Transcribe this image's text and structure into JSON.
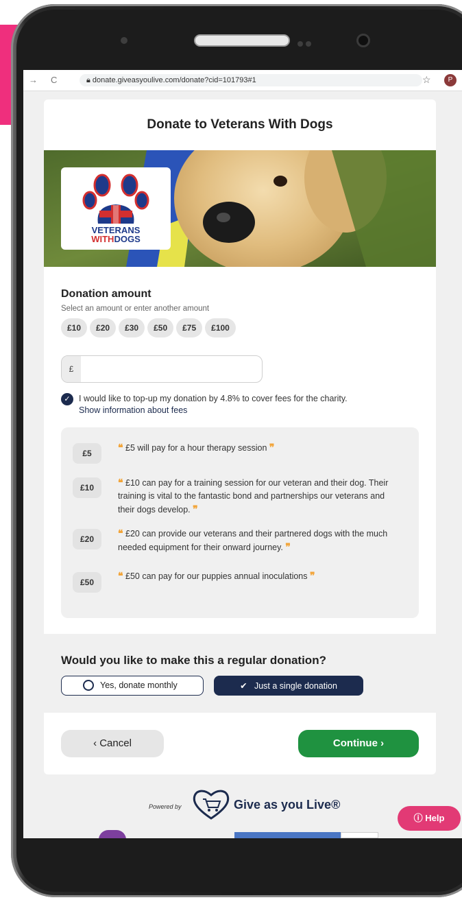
{
  "browser": {
    "url": "donate.giveasyoulive.com/donate?cid=101793#1",
    "profile_initial": "P"
  },
  "donate": {
    "title": "Donate to Veterans With Dogs",
    "logo": {
      "line1": "VETERANS",
      "line2_a": "WITH",
      "line2_b": "DOGS"
    },
    "amount_heading": "Donation amount",
    "amount_subtitle": "Select an amount or enter another amount",
    "amounts": [
      "£10",
      "£20",
      "£30",
      "£50",
      "£75",
      "£100"
    ],
    "currency_symbol": "£",
    "custom_amount_value": "",
    "topup_text": "I would like to top-up my donation by 4.8% to cover fees for the charity.",
    "fee_link": "Show information about fees",
    "quotes": [
      {
        "amount": "£5",
        "text": "£5 will pay for a hour therapy session"
      },
      {
        "amount": "£10",
        "text": "£10 can pay for a training session for our veteran and their dog. Their training is vital to the fantastic bond and partnerships our veterans and their dogs develop."
      },
      {
        "amount": "£20",
        "text": "£20 can provide our veterans and their partnered dogs with the much needed equipment for their onward journey."
      },
      {
        "amount": "£50",
        "text": "£50 can pay for our puppies annual inoculations"
      }
    ],
    "regular_heading": "Would you like to make this a regular donation?",
    "monthly_label": "Yes, donate monthly",
    "single_label": "Just a single donation",
    "cancel_label": "‹ Cancel",
    "continue_label": "Continue ›"
  },
  "footer": {
    "powered_by": "Powered by",
    "brand": "Give as you Live®",
    "help_label": "Help"
  },
  "colors": {
    "accent_pink": "#ef2f7d",
    "navy": "#1c2b4e",
    "green": "#1f9240",
    "help_pink": "#e23a75",
    "quote_mark": "#f2a53a"
  }
}
